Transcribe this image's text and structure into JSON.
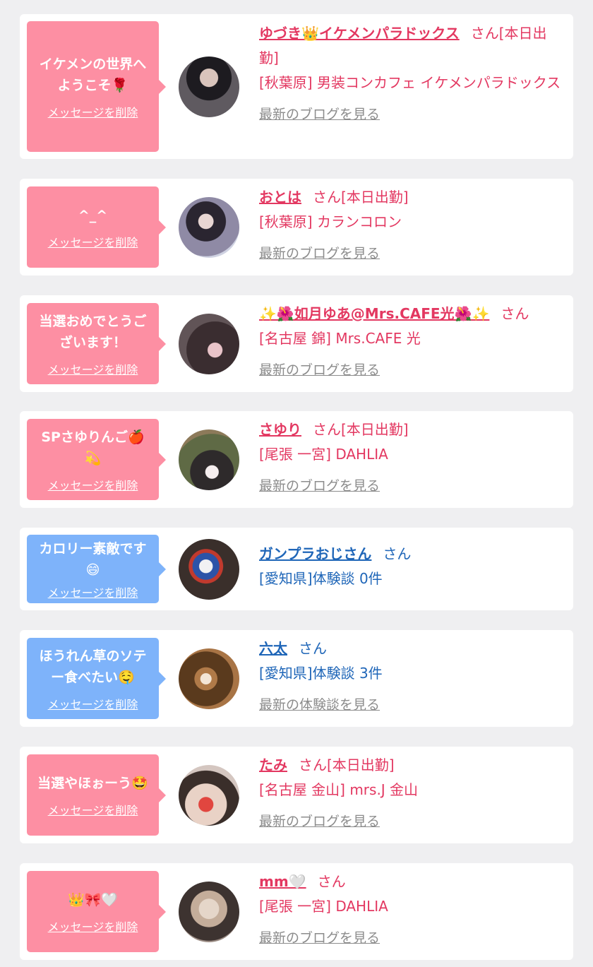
{
  "delete_label": "メッセージを削除",
  "san": "さん",
  "cards": [
    {
      "message": "イケメンの世界へようこそ🌹",
      "name": "ゆづき👑イケメンパラドックス",
      "suffix": "さん[本日出勤]",
      "shop": "[秋葉原] 男装コンカフェ イケメンパラドックス",
      "link": "最新のブログを見る",
      "theme": "pink"
    },
    {
      "message": "^_^",
      "name": "おとは",
      "suffix": "さん[本日出勤]",
      "shop": "[秋葉原] カランコロン",
      "link": "最新のブログを見る",
      "theme": "pink"
    },
    {
      "message": "当選おめでとうございます！",
      "name": "✨🌺如月ゆあ@Mrs.CAFE光🌺✨",
      "suffix": "さん",
      "shop": "[名古屋 錦] Mrs.CAFE 光",
      "link": "最新のブログを見る",
      "theme": "pink"
    },
    {
      "message": "SPさゆりんご🍎💫",
      "name": "さゆり",
      "suffix": "さん[本日出勤]",
      "shop": "[尾張 一宮] DAHLIA",
      "link": "最新のブログを見る",
      "theme": "pink"
    },
    {
      "message": "カロリー素敵です😄",
      "name": "ガンプラおじさん",
      "suffix": "さん",
      "shop": "[愛知県]体験談 0件",
      "link": "",
      "theme": "blue"
    },
    {
      "message": "ほうれん草のソテー食べたい🤤",
      "name": "六太",
      "suffix": "さん",
      "shop": "[愛知県]体験談 3件",
      "link": "最新の体験談を見る",
      "theme": "blue"
    },
    {
      "message": "当選やほぉーう🤩",
      "name": "たみ",
      "suffix": "さん[本日出勤]",
      "shop": "[名古屋 金山] mrs.J 金山",
      "link": "最新のブログを見る",
      "theme": "pink"
    },
    {
      "message": "👑🎀🤍",
      "name": "mm🤍",
      "suffix": "さん",
      "shop": "[尾張 一宮] DAHLIA",
      "link": "最新のブログを見る",
      "theme": "pink"
    }
  ]
}
